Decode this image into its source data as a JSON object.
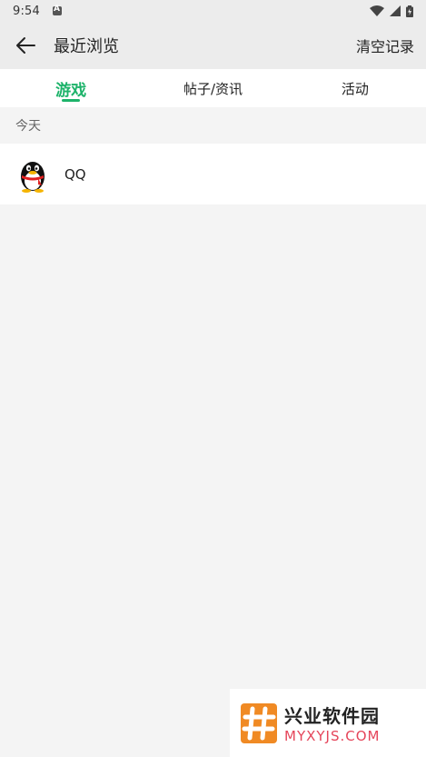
{
  "status_bar": {
    "time": "9:54"
  },
  "app_bar": {
    "title": "最近浏览",
    "clear_label": "清空记录"
  },
  "tabs": [
    {
      "label": "游戏",
      "active": true
    },
    {
      "label": "帖子/资讯",
      "active": false
    },
    {
      "label": "活动",
      "active": false
    }
  ],
  "section": {
    "label": "今天"
  },
  "items": [
    {
      "name": "QQ",
      "icon": "qq-penguin-icon"
    }
  ],
  "watermark": {
    "cn": "兴业软件园",
    "en": "MYXYJS.COM"
  },
  "colors": {
    "accent": "#1db36a",
    "background": "#f4f4f4",
    "watermark_red": "#e5455a"
  }
}
